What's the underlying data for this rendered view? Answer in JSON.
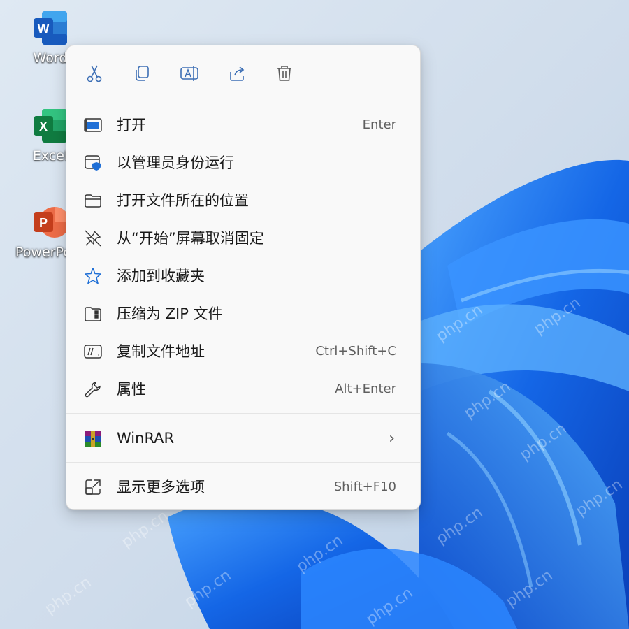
{
  "desktop": {
    "icons": [
      {
        "label": "Word",
        "icon": "word-icon"
      },
      {
        "label": "Excel",
        "icon": "excel-icon"
      },
      {
        "label": "PowerPoint",
        "icon": "powerpoint-icon"
      }
    ],
    "watermark": "php.cn"
  },
  "menu": {
    "quick_actions": [
      {
        "icon": "cut-icon"
      },
      {
        "icon": "copy-icon"
      },
      {
        "icon": "rename-icon"
      },
      {
        "icon": "share-icon"
      },
      {
        "icon": "delete-icon"
      }
    ],
    "items": [
      {
        "label": "打开",
        "shortcut": "Enter",
        "icon": "open-icon"
      },
      {
        "label": "以管理员身份运行",
        "shortcut": "",
        "icon": "run-as-admin-icon"
      },
      {
        "label": "打开文件所在的位置",
        "shortcut": "",
        "icon": "folder-icon"
      },
      {
        "label": "从“开始”屏幕取消固定",
        "shortcut": "",
        "icon": "unpin-icon"
      },
      {
        "label": "添加到收藏夹",
        "shortcut": "",
        "icon": "star-icon"
      },
      {
        "label": "压缩为 ZIP 文件",
        "shortcut": "",
        "icon": "zip-icon"
      },
      {
        "label": "复制文件地址",
        "shortcut": "Ctrl+Shift+C",
        "icon": "copy-path-icon"
      },
      {
        "label": "属性",
        "shortcut": "Alt+Enter",
        "icon": "wrench-icon"
      },
      {
        "label": "WinRAR",
        "shortcut": "",
        "icon": "winrar-icon"
      },
      {
        "label": "显示更多选项",
        "shortcut": "Shift+F10",
        "icon": "more-options-icon"
      }
    ]
  },
  "colors": {
    "accent": "#1f6fd6",
    "menu_bg": "#f9f9f9",
    "wallpaper_blue": "#1a5fe8"
  }
}
